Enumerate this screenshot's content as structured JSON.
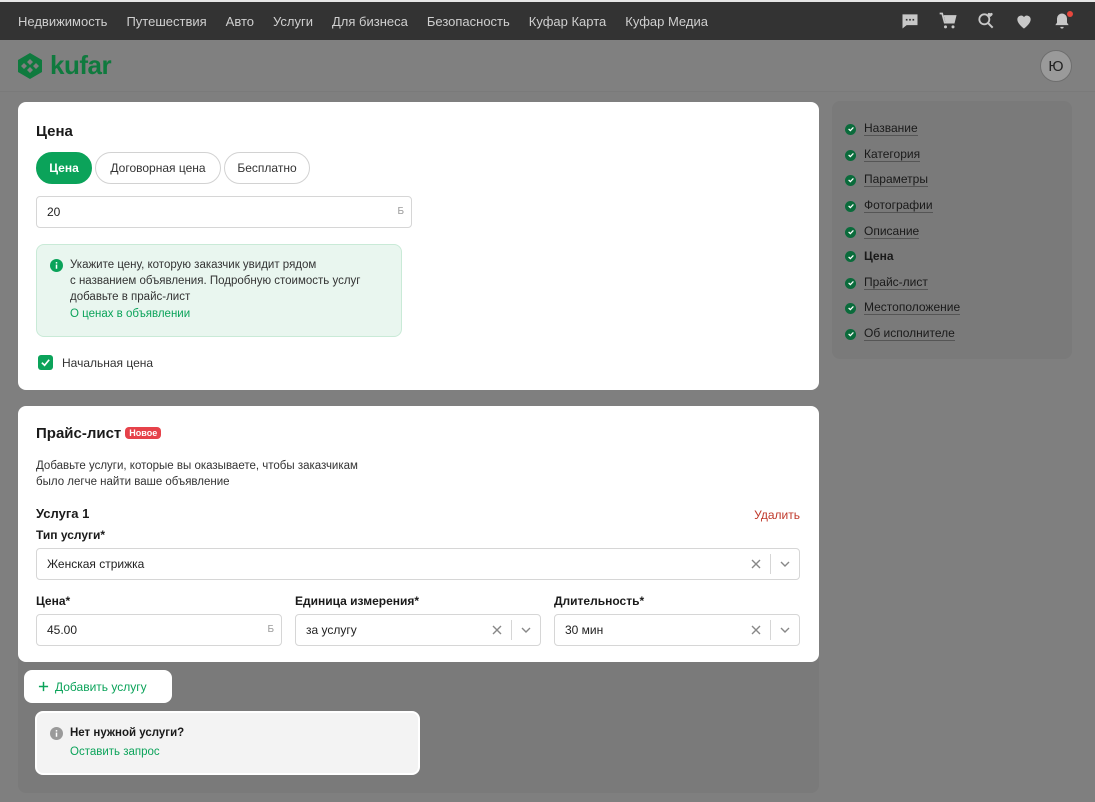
{
  "topnav": {
    "items": [
      "Недвижимость",
      "Путешествия",
      "Авто",
      "Услуги",
      "Для бизнеса",
      "Безопасность",
      "Куфар Карта",
      "Куфар Медиа"
    ],
    "icons": [
      "chat-icon",
      "cart-icon",
      "search-heart-icon",
      "heart-icon",
      "bell-icon"
    ]
  },
  "header": {
    "logo_text": "kufar",
    "avatar_letter": "Ю"
  },
  "price": {
    "title": "Цена",
    "options": [
      "Цена",
      "Договорная цена",
      "Бесплатно"
    ],
    "selected": "Цена",
    "value": "20",
    "currency": "Б",
    "info_text": [
      "Укажите цену, которую заказчик увидит рядом",
      "с названием объявления. Подробную стоимость услуг",
      "добавьте в прайс-лист"
    ],
    "info_link": "О ценах в объявлении",
    "checkbox_label": "Начальная цена",
    "checkbox_checked": true
  },
  "pricelist": {
    "title": "Прайс-лист",
    "badge": "Новое",
    "description": [
      "Добавьте услуги, которые вы оказываете, чтобы заказчикам",
      "было легче найти ваше объявление"
    ],
    "service_title": "Услуга 1",
    "delete_label": "Удалить",
    "type_label": "Тип услуги*",
    "type_value": "Женская стрижка",
    "price_label": "Цена*",
    "price_value": "45.00",
    "currency": "Б",
    "unit_label": "Единица измерения*",
    "unit_value": "за услугу",
    "duration_label": "Длительность*",
    "duration_value": "30 мин",
    "add_label": "Добавить услугу",
    "no_service_title": "Нет нужной услуги?",
    "no_service_link": "Оставить запрос"
  },
  "sidebar": {
    "items": [
      "Название",
      "Категория",
      "Параметры",
      "Фотографии",
      "Описание",
      "Цена",
      "Прайс-лист",
      "Местоположение",
      "Об исполнителе"
    ],
    "current": "Цена"
  },
  "colors": {
    "accent": "#0ba35a",
    "badge": "#e6424a",
    "delete": "#c0392b"
  }
}
